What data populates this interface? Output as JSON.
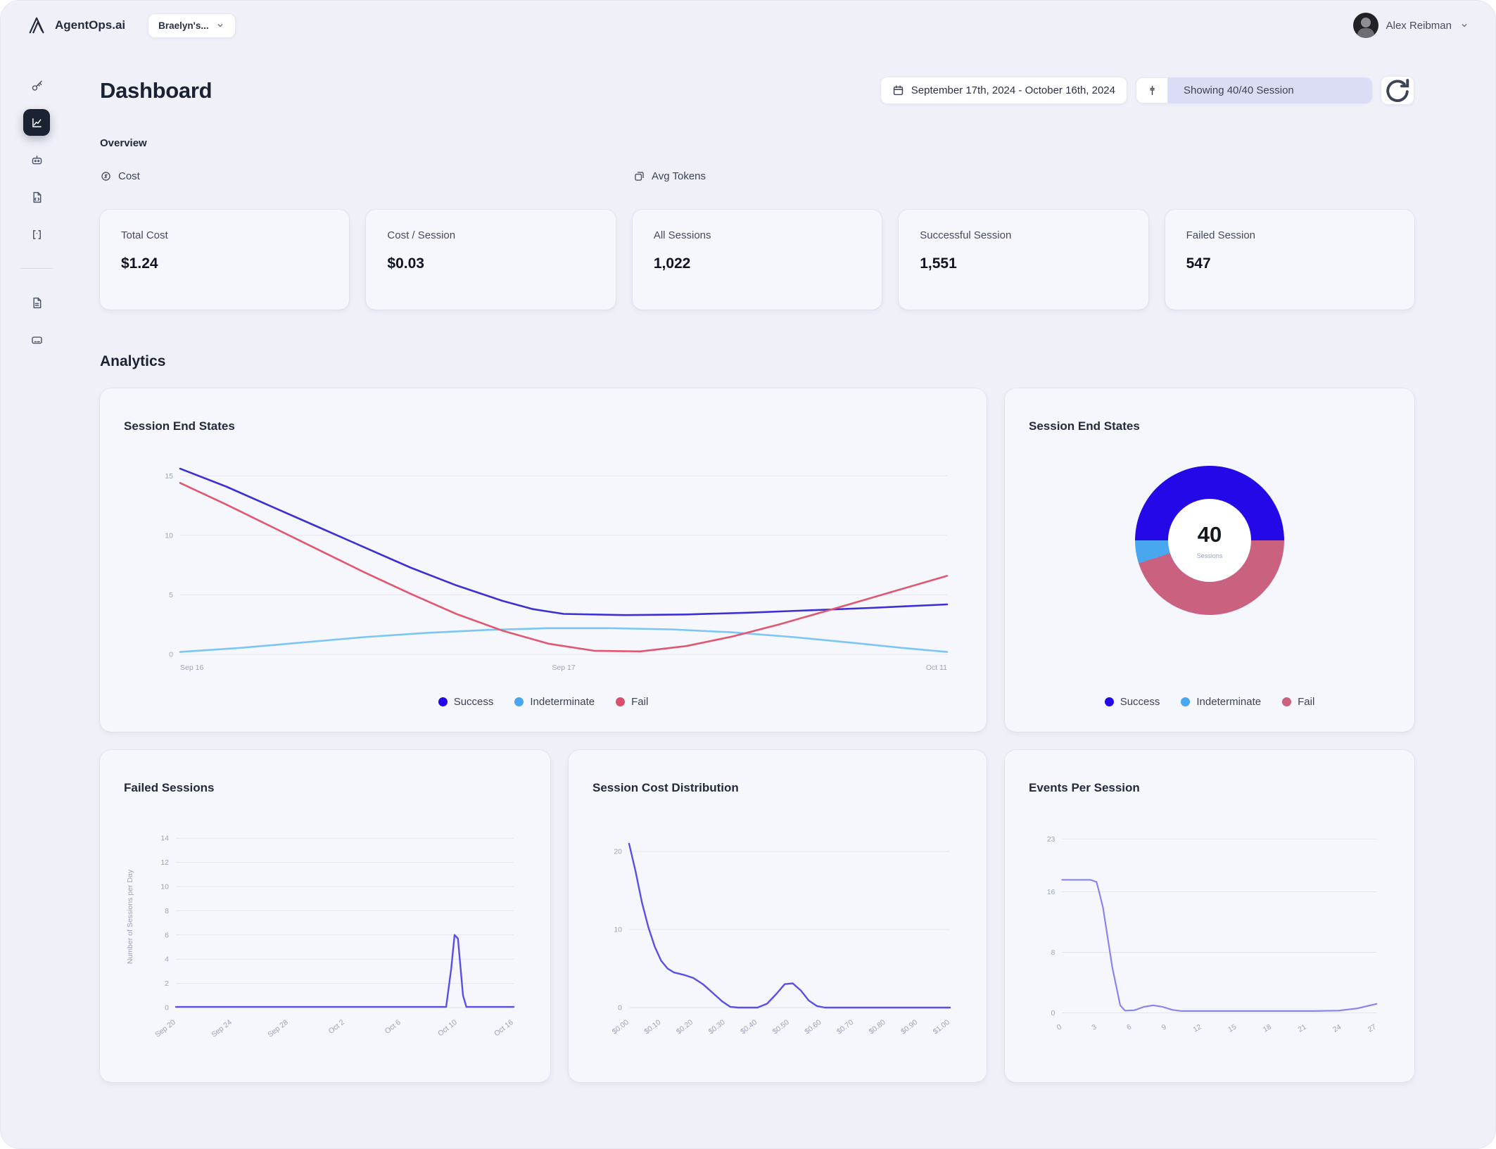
{
  "topbar": {
    "brand": "AgentOps.ai",
    "project": "Braelyn's...",
    "user": "Alex Reibman"
  },
  "header": {
    "title": "Dashboard",
    "date_range": "September 17th, 2024 - October 16th, 2024",
    "showing": "Showing 40/40 Session"
  },
  "overview": {
    "heading": "Overview",
    "tab_cost": "Cost",
    "tab_tokens": "Avg Tokens",
    "stats": [
      {
        "label": "Total Cost",
        "value": "$1.24"
      },
      {
        "label": "Cost / Session",
        "value": "$0.03"
      },
      {
        "label": "All Sessions",
        "value": "1,022"
      },
      {
        "label": "Successful Session",
        "value": "1,551"
      },
      {
        "label": "Failed Session",
        "value": "547"
      }
    ]
  },
  "analytics": {
    "heading": "Analytics"
  },
  "colors": {
    "accent": "#5b4ee8",
    "success": "#2408e8",
    "indeterminate": "#49a7ef",
    "fail": "#c9617f",
    "active_nav_bg": "#1b2232",
    "showing_pill_bg": "#dbdcf5"
  },
  "chart_data": {
    "session_end_states_line": {
      "type": "line",
      "title": "Session End States",
      "ylim": [
        0,
        16.2
      ],
      "yticks": [
        0,
        5,
        10,
        15
      ],
      "x_tick_labels": [
        {
          "f": 0,
          "label": "Sep 16"
        },
        {
          "f": 0.5,
          "label": "Sep 17"
        },
        {
          "f": 1,
          "label": "Oct 11"
        }
      ],
      "legend": [
        "Success",
        "Indeterminate",
        "Fail"
      ],
      "stroke": 2.6,
      "series": [
        {
          "name": "Success",
          "color": "#3d2ed6",
          "points": [
            [
              0,
              15.6
            ],
            [
              0.06,
              14.1
            ],
            [
              0.12,
              12.4
            ],
            [
              0.18,
              10.7
            ],
            [
              0.24,
              9.0
            ],
            [
              0.3,
              7.3
            ],
            [
              0.36,
              5.8
            ],
            [
              0.42,
              4.5
            ],
            [
              0.46,
              3.8
            ],
            [
              0.5,
              3.4
            ],
            [
              0.58,
              3.3
            ],
            [
              0.66,
              3.35
            ],
            [
              0.74,
              3.5
            ],
            [
              0.82,
              3.7
            ],
            [
              0.9,
              3.9
            ],
            [
              1,
              4.2
            ]
          ]
        },
        {
          "name": "Indeterminate",
          "color": "#7cc6f5",
          "points": [
            [
              0,
              0.2
            ],
            [
              0.08,
              0.55
            ],
            [
              0.16,
              1.0
            ],
            [
              0.24,
              1.45
            ],
            [
              0.32,
              1.8
            ],
            [
              0.4,
              2.05
            ],
            [
              0.48,
              2.2
            ],
            [
              0.56,
              2.2
            ],
            [
              0.64,
              2.1
            ],
            [
              0.72,
              1.85
            ],
            [
              0.8,
              1.45
            ],
            [
              0.88,
              0.95
            ],
            [
              0.94,
              0.55
            ],
            [
              1,
              0.2
            ]
          ]
        },
        {
          "name": "Fail",
          "color": "#e2566f",
          "points": [
            [
              0,
              14.4
            ],
            [
              0.06,
              12.6
            ],
            [
              0.12,
              10.7
            ],
            [
              0.18,
              8.8
            ],
            [
              0.24,
              6.9
            ],
            [
              0.3,
              5.1
            ],
            [
              0.36,
              3.4
            ],
            [
              0.42,
              2.0
            ],
            [
              0.48,
              0.9
            ],
            [
              0.54,
              0.3
            ],
            [
              0.6,
              0.25
            ],
            [
              0.66,
              0.7
            ],
            [
              0.72,
              1.5
            ],
            [
              0.78,
              2.5
            ],
            [
              0.84,
              3.6
            ],
            [
              0.92,
              5.1
            ],
            [
              1,
              6.6
            ]
          ]
        }
      ]
    },
    "session_end_states_donut": {
      "type": "pie",
      "title": "Session End States",
      "center_value": "40",
      "center_label": "Sessions",
      "start_angle_deg": 270,
      "slices": [
        {
          "label": "Success",
          "value": 50,
          "color": "#2408e8"
        },
        {
          "label": "Fail",
          "value": 45,
          "color": "#c9617f"
        },
        {
          "label": "Indeterminate",
          "value": 5,
          "color": "#49a7ef"
        }
      ],
      "legend": [
        "Success",
        "Indeterminate",
        "Fail"
      ]
    },
    "failed_sessions": {
      "type": "line",
      "title": "Failed Sessions",
      "ylabel": "Number of Sessions per Day",
      "ylim": [
        0,
        15
      ],
      "yticks": [
        0,
        2,
        4,
        6,
        8,
        10,
        12,
        14
      ],
      "categories": [
        "Sep 20",
        "Sep 24",
        "Sep 28",
        "Oct 2",
        "Oct 6",
        "Oct 10",
        "Oct 16"
      ],
      "rotate_x": -38,
      "stroke": 2.4,
      "series": [
        {
          "name": "Failed Sessions",
          "color": "#5b4ee8",
          "points": [
            [
              0,
              0.05
            ],
            [
              0.76,
              0.05
            ],
            [
              0.8,
              0.05
            ],
            [
              0.815,
              3.2
            ],
            [
              0.825,
              6.0
            ],
            [
              0.835,
              5.7
            ],
            [
              0.85,
              1.0
            ],
            [
              0.86,
              0.05
            ],
            [
              1,
              0.05
            ]
          ]
        }
      ]
    },
    "session_cost_distribution": {
      "type": "line",
      "title": "Session Cost Distribution",
      "ylim": [
        0,
        22
      ],
      "yticks": [
        0,
        10,
        20
      ],
      "categories": [
        "$0.00",
        "$0.10",
        "$0.20",
        "$0.30",
        "$0.40",
        "$0.50",
        "$0.60",
        "$0.70",
        "$0.80",
        "$0.90",
        "$1.00"
      ],
      "rotate_x": -38,
      "stroke": 2.4,
      "series": [
        {
          "name": "Sessions",
          "color": "#5b4ee8",
          "points": [
            [
              0,
              21
            ],
            [
              0.02,
              17.5
            ],
            [
              0.04,
              13.5
            ],
            [
              0.06,
              10.3
            ],
            [
              0.08,
              7.8
            ],
            [
              0.1,
              6.0
            ],
            [
              0.12,
              5.0
            ],
            [
              0.14,
              4.5
            ],
            [
              0.17,
              4.2
            ],
            [
              0.2,
              3.8
            ],
            [
              0.23,
              3.0
            ],
            [
              0.26,
              1.9
            ],
            [
              0.29,
              0.8
            ],
            [
              0.315,
              0.1
            ],
            [
              0.34,
              0
            ],
            [
              0.4,
              0
            ],
            [
              0.43,
              0.5
            ],
            [
              0.46,
              1.8
            ],
            [
              0.485,
              3.0
            ],
            [
              0.51,
              3.1
            ],
            [
              0.535,
              2.2
            ],
            [
              0.56,
              0.9
            ],
            [
              0.585,
              0.2
            ],
            [
              0.61,
              0
            ],
            [
              1,
              0
            ]
          ]
        }
      ]
    },
    "events_per_session": {
      "type": "line",
      "title": "Events Per Session",
      "ylim": [
        0,
        24
      ],
      "yticks": [
        0,
        8,
        16,
        23
      ],
      "categories": [
        "0",
        "3",
        "6",
        "9",
        "12",
        "15",
        "18",
        "21",
        "24",
        "27"
      ],
      "rotate_x": -30,
      "stroke": 2.2,
      "series": [
        {
          "name": "Events",
          "color": "#8a82f2",
          "points": [
            [
              0,
              17.6
            ],
            [
              0.09,
              17.6
            ],
            [
              0.11,
              17.3
            ],
            [
              0.13,
              14
            ],
            [
              0.16,
              6
            ],
            [
              0.185,
              1
            ],
            [
              0.2,
              0.3
            ],
            [
              0.23,
              0.35
            ],
            [
              0.26,
              0.8
            ],
            [
              0.29,
              1.0
            ],
            [
              0.32,
              0.8
            ],
            [
              0.35,
              0.4
            ],
            [
              0.38,
              0.25
            ],
            [
              0.8,
              0.25
            ],
            [
              0.88,
              0.3
            ],
            [
              0.94,
              0.6
            ],
            [
              1,
              1.2
            ]
          ]
        }
      ]
    }
  }
}
